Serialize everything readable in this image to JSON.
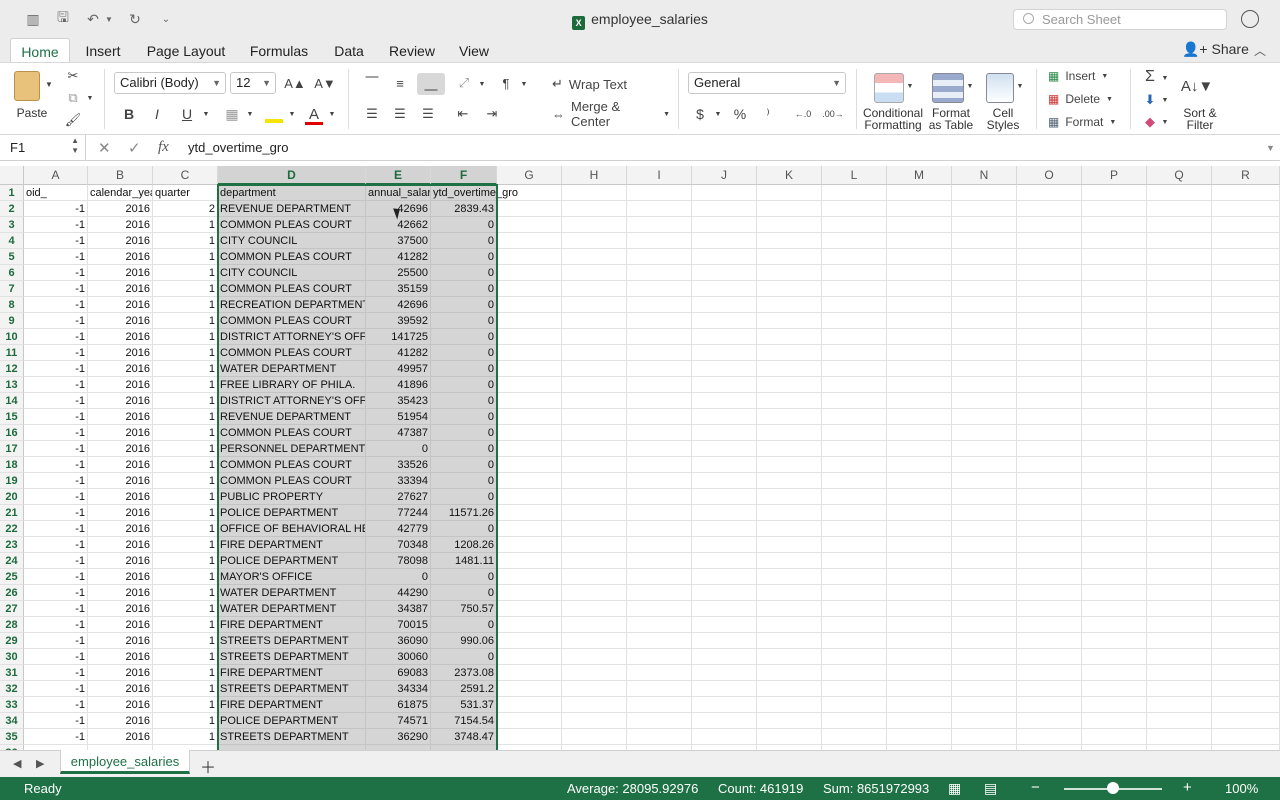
{
  "window": {
    "title": "employee_salaries",
    "search_placeholder": "Search Sheet"
  },
  "tabs": [
    "Home",
    "Insert",
    "Page Layout",
    "Formulas",
    "Data",
    "Review",
    "View"
  ],
  "share_label": "Share",
  "ribbon": {
    "paste": "Paste",
    "font_name": "Calibri (Body)",
    "font_size": "12",
    "bold": "B",
    "italic": "I",
    "underline": "U",
    "wrap_text": "Wrap Text",
    "merge_center": "Merge & Center",
    "number_format": "General",
    "currency": "$",
    "percent": "%",
    "conditional_formatting": [
      "Conditional",
      "Formatting"
    ],
    "format_as_table": [
      "Format",
      "as Table"
    ],
    "cell_styles": [
      "Cell",
      "Styles"
    ],
    "insert": "Insert",
    "delete": "Delete",
    "format": "Format",
    "sort_filter": [
      "Sort &",
      "Filter"
    ]
  },
  "formula_bar": {
    "name_box": "F1",
    "fx": "fx",
    "content": "ytd_overtime_gro"
  },
  "columns": [
    "A",
    "B",
    "C",
    "D",
    "E",
    "F",
    "G",
    "H",
    "I",
    "J",
    "K",
    "L",
    "M",
    "N",
    "O",
    "P",
    "Q",
    "R"
  ],
  "header_row": [
    "oid_",
    "calendar_yea",
    "quarter",
    "department",
    "annual_salar",
    "ytd_overtime_gro"
  ],
  "rows": [
    [
      "-1",
      "2016",
      "2",
      "REVENUE DEPARTMENT",
      "42696",
      "2839.43"
    ],
    [
      "-1",
      "2016",
      "1",
      "COMMON PLEAS COURT",
      "42662",
      "0"
    ],
    [
      "-1",
      "2016",
      "1",
      "CITY COUNCIL",
      "37500",
      "0"
    ],
    [
      "-1",
      "2016",
      "1",
      "COMMON PLEAS COURT",
      "41282",
      "0"
    ],
    [
      "-1",
      "2016",
      "1",
      "CITY COUNCIL",
      "25500",
      "0"
    ],
    [
      "-1",
      "2016",
      "1",
      "COMMON PLEAS COURT",
      "35159",
      "0"
    ],
    [
      "-1",
      "2016",
      "1",
      "RECREATION DEPARTMENT",
      "42696",
      "0"
    ],
    [
      "-1",
      "2016",
      "1",
      "COMMON PLEAS COURT",
      "39592",
      "0"
    ],
    [
      "-1",
      "2016",
      "1",
      "DISTRICT ATTORNEY'S OFFICE",
      "141725",
      "0"
    ],
    [
      "-1",
      "2016",
      "1",
      "COMMON PLEAS COURT",
      "41282",
      "0"
    ],
    [
      "-1",
      "2016",
      "1",
      "WATER DEPARTMENT",
      "49957",
      "0"
    ],
    [
      "-1",
      "2016",
      "1",
      "FREE LIBRARY OF PHILA.",
      "41896",
      "0"
    ],
    [
      "-1",
      "2016",
      "1",
      "DISTRICT ATTORNEY'S OFFICE",
      "35423",
      "0"
    ],
    [
      "-1",
      "2016",
      "1",
      "REVENUE DEPARTMENT",
      "51954",
      "0"
    ],
    [
      "-1",
      "2016",
      "1",
      "COMMON PLEAS COURT",
      "47387",
      "0"
    ],
    [
      "-1",
      "2016",
      "1",
      "PERSONNEL DEPARTMENT",
      "0",
      "0"
    ],
    [
      "-1",
      "2016",
      "1",
      "COMMON PLEAS COURT",
      "33526",
      "0"
    ],
    [
      "-1",
      "2016",
      "1",
      "COMMON PLEAS COURT",
      "33394",
      "0"
    ],
    [
      "-1",
      "2016",
      "1",
      "PUBLIC PROPERTY",
      "27627",
      "0"
    ],
    [
      "-1",
      "2016",
      "1",
      "POLICE DEPARTMENT",
      "77244",
      "11571.26"
    ],
    [
      "-1",
      "2016",
      "1",
      "OFFICE OF BEHAVIORAL HEAL",
      "42779",
      "0"
    ],
    [
      "-1",
      "2016",
      "1",
      "FIRE DEPARTMENT",
      "70348",
      "1208.26"
    ],
    [
      "-1",
      "2016",
      "1",
      "POLICE DEPARTMENT",
      "78098",
      "1481.11"
    ],
    [
      "-1",
      "2016",
      "1",
      "MAYOR'S OFFICE",
      "0",
      "0"
    ],
    [
      "-1",
      "2016",
      "1",
      "WATER DEPARTMENT",
      "44290",
      "0"
    ],
    [
      "-1",
      "2016",
      "1",
      "WATER DEPARTMENT",
      "34387",
      "750.57"
    ],
    [
      "-1",
      "2016",
      "1",
      "FIRE DEPARTMENT",
      "70015",
      "0"
    ],
    [
      "-1",
      "2016",
      "1",
      "STREETS DEPARTMENT",
      "36090",
      "990.06"
    ],
    [
      "-1",
      "2016",
      "1",
      "STREETS DEPARTMENT",
      "30060",
      "0"
    ],
    [
      "-1",
      "2016",
      "1",
      "FIRE DEPARTMENT",
      "69083",
      "2373.08"
    ],
    [
      "-1",
      "2016",
      "1",
      "STREETS DEPARTMENT",
      "34334",
      "2591.2"
    ],
    [
      "-1",
      "2016",
      "1",
      "FIRE DEPARTMENT",
      "61875",
      "531.37"
    ],
    [
      "-1",
      "2016",
      "1",
      "POLICE DEPARTMENT",
      "74571",
      "7154.54"
    ],
    [
      "-1",
      "2016",
      "1",
      "STREETS DEPARTMENT",
      "36290",
      "3748.47"
    ]
  ],
  "sheet_tab": "employee_salaries",
  "status": {
    "ready": "Ready",
    "average": "Average: 28095.92976",
    "count": "Count: 461919",
    "sum": "Sum: 8651972993",
    "zoom": "100%"
  },
  "colors": {
    "accent": "#1e7145",
    "selection": "#d5d5d5"
  }
}
